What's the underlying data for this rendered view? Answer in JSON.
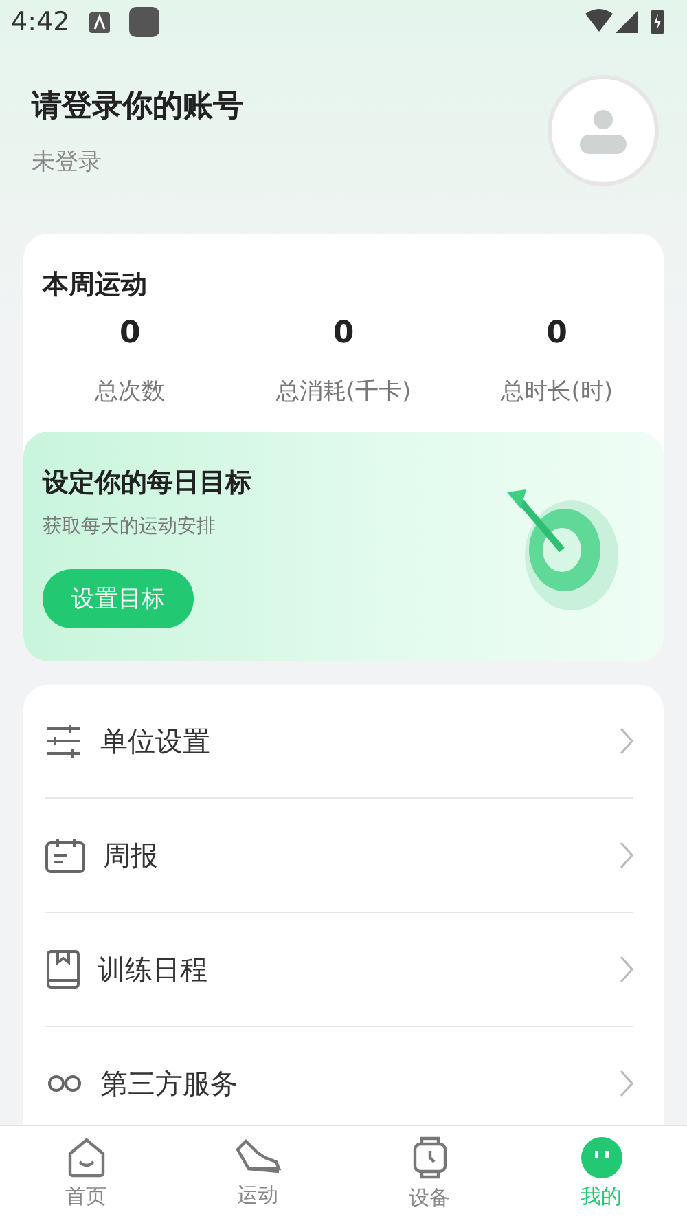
{
  "status_bar": {
    "time": "4:42"
  },
  "profile": {
    "title": "请登录你的账号",
    "subtitle": "未登录"
  },
  "week": {
    "title": "本周运动",
    "stats": [
      {
        "value": "0",
        "label": "总次数"
      },
      {
        "value": "0",
        "label": "总消耗(千卡)"
      },
      {
        "value": "0",
        "label": "总时长(时)"
      }
    ]
  },
  "goal": {
    "title": "设定你的每日目标",
    "subtitle": "获取每天的运动安排",
    "button": "设置目标"
  },
  "menu": [
    {
      "kind": "sliders",
      "label": "单位设置"
    },
    {
      "kind": "calendar",
      "label": "周报"
    },
    {
      "kind": "book",
      "label": "训练日程"
    },
    {
      "kind": "people",
      "label": "第三方服务"
    }
  ],
  "tabs": [
    {
      "kind": "home",
      "label": "首页",
      "selected": false
    },
    {
      "kind": "shoe",
      "label": "运动",
      "selected": false
    },
    {
      "kind": "watch",
      "label": "设备",
      "selected": false
    },
    {
      "kind": "me",
      "label": "我的",
      "selected": true
    }
  ]
}
